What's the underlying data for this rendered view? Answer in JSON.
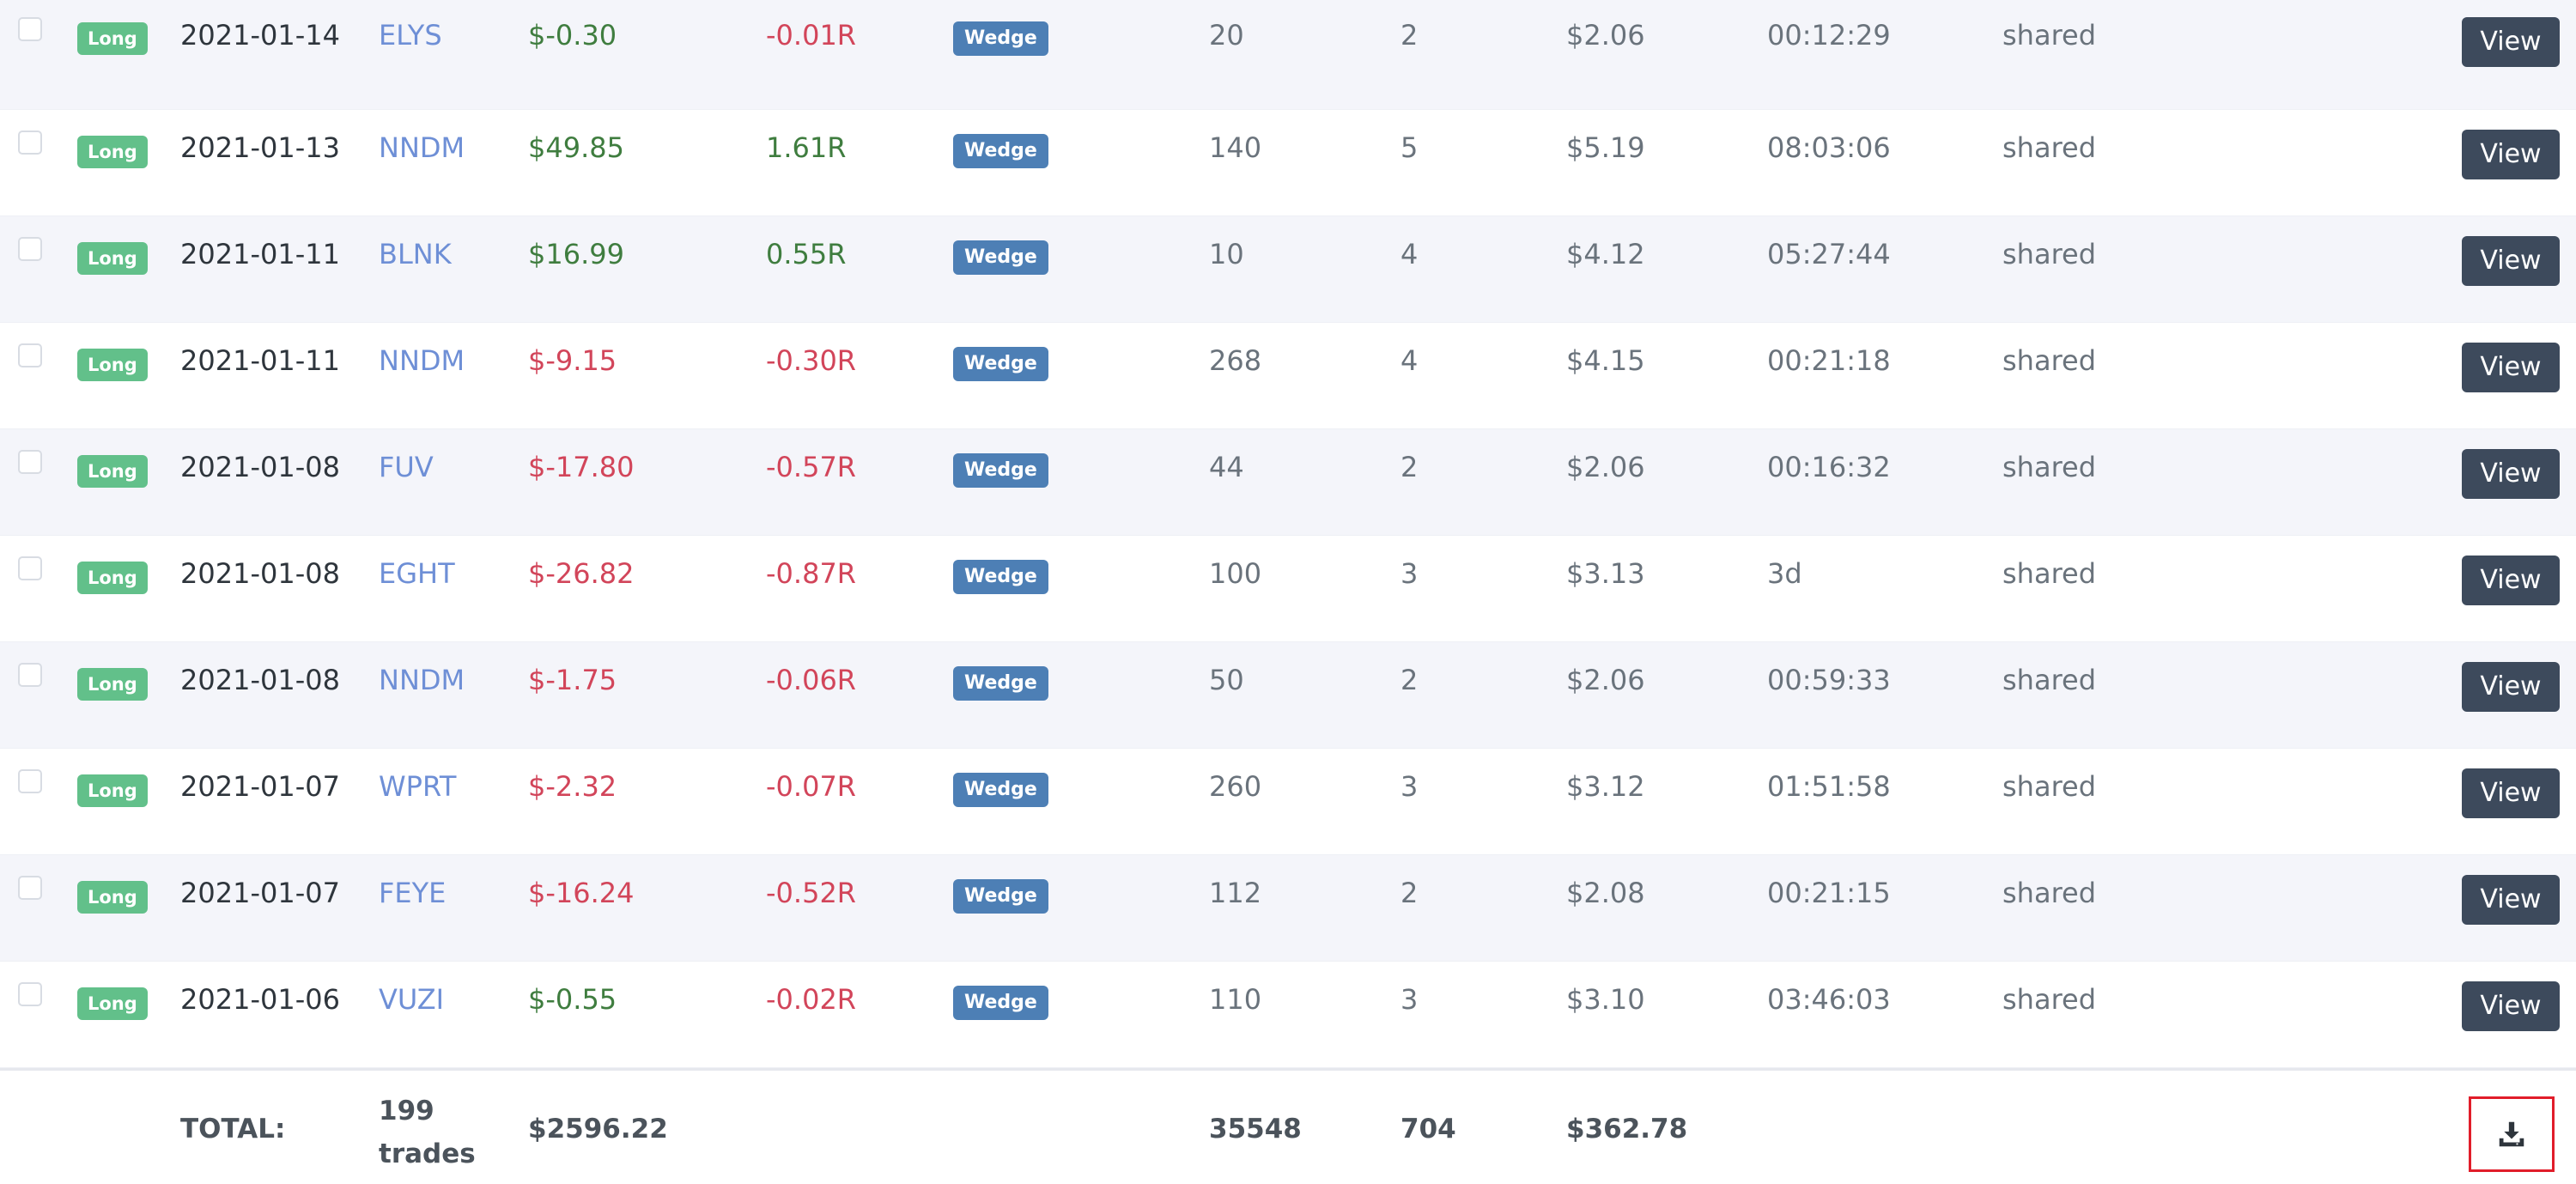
{
  "trades": [
    {
      "side": "Long",
      "date": "2021-01-14",
      "symbol": "ELYS",
      "pnl": "$-0.30",
      "r": "-0.01R",
      "pnl_status": "pos",
      "r_status": "neg",
      "tag": "Wedge",
      "qty": "20",
      "executions": "2",
      "fees": "$2.06",
      "duration": "00:12:29",
      "visibility": "shared",
      "action_label": "View"
    },
    {
      "side": "Long",
      "date": "2021-01-13",
      "symbol": "NNDM",
      "pnl": "$49.85",
      "r": "1.61R",
      "pnl_status": "pos",
      "r_status": "pos",
      "tag": "Wedge",
      "qty": "140",
      "executions": "5",
      "fees": "$5.19",
      "duration": "08:03:06",
      "visibility": "shared",
      "action_label": "View"
    },
    {
      "side": "Long",
      "date": "2021-01-11",
      "symbol": "BLNK",
      "pnl": "$16.99",
      "r": "0.55R",
      "pnl_status": "pos",
      "r_status": "pos",
      "tag": "Wedge",
      "qty": "10",
      "executions": "4",
      "fees": "$4.12",
      "duration": "05:27:44",
      "visibility": "shared",
      "action_label": "View"
    },
    {
      "side": "Long",
      "date": "2021-01-11",
      "symbol": "NNDM",
      "pnl": "$-9.15",
      "r": "-0.30R",
      "pnl_status": "neg",
      "r_status": "neg",
      "tag": "Wedge",
      "qty": "268",
      "executions": "4",
      "fees": "$4.15",
      "duration": "00:21:18",
      "visibility": "shared",
      "action_label": "View"
    },
    {
      "side": "Long",
      "date": "2021-01-08",
      "symbol": "FUV",
      "pnl": "$-17.80",
      "r": "-0.57R",
      "pnl_status": "neg",
      "r_status": "neg",
      "tag": "Wedge",
      "qty": "44",
      "executions": "2",
      "fees": "$2.06",
      "duration": "00:16:32",
      "visibility": "shared",
      "action_label": "View"
    },
    {
      "side": "Long",
      "date": "2021-01-08",
      "symbol": "EGHT",
      "pnl": "$-26.82",
      "r": "-0.87R",
      "pnl_status": "neg",
      "r_status": "neg",
      "tag": "Wedge",
      "qty": "100",
      "executions": "3",
      "fees": "$3.13",
      "duration": "3d",
      "visibility": "shared",
      "action_label": "View"
    },
    {
      "side": "Long",
      "date": "2021-01-08",
      "symbol": "NNDM",
      "pnl": "$-1.75",
      "r": "-0.06R",
      "pnl_status": "neg",
      "r_status": "neg",
      "tag": "Wedge",
      "qty": "50",
      "executions": "2",
      "fees": "$2.06",
      "duration": "00:59:33",
      "visibility": "shared",
      "action_label": "View"
    },
    {
      "side": "Long",
      "date": "2021-01-07",
      "symbol": "WPRT",
      "pnl": "$-2.32",
      "r": "-0.07R",
      "pnl_status": "neg",
      "r_status": "neg",
      "tag": "Wedge",
      "qty": "260",
      "executions": "3",
      "fees": "$3.12",
      "duration": "01:51:58",
      "visibility": "shared",
      "action_label": "View"
    },
    {
      "side": "Long",
      "date": "2021-01-07",
      "symbol": "FEYE",
      "pnl": "$-16.24",
      "r": "-0.52R",
      "pnl_status": "neg",
      "r_status": "neg",
      "tag": "Wedge",
      "qty": "112",
      "executions": "2",
      "fees": "$2.08",
      "duration": "00:21:15",
      "visibility": "shared",
      "action_label": "View"
    },
    {
      "side": "Long",
      "date": "2021-01-06",
      "symbol": "VUZI",
      "pnl": "$-0.55",
      "r": "-0.02R",
      "pnl_status": "pos",
      "r_status": "neg",
      "tag": "Wedge",
      "qty": "110",
      "executions": "3",
      "fees": "$3.10",
      "duration": "03:46:03",
      "visibility": "shared",
      "action_label": "View"
    }
  ],
  "totals": {
    "label": "TOTAL:",
    "trades": "199 trades",
    "pnl": "$2596.22",
    "qty": "35548",
    "executions": "704",
    "fees": "$362.78",
    "download_icon": "download-icon"
  },
  "colors": {
    "positive": "#3f7d3f",
    "negative": "#d2455a",
    "long_badge": "#62c08a",
    "tag_badge": "#4d7fb5",
    "view_button": "#3d4a5c",
    "highlight_border": "#e11d2a"
  }
}
